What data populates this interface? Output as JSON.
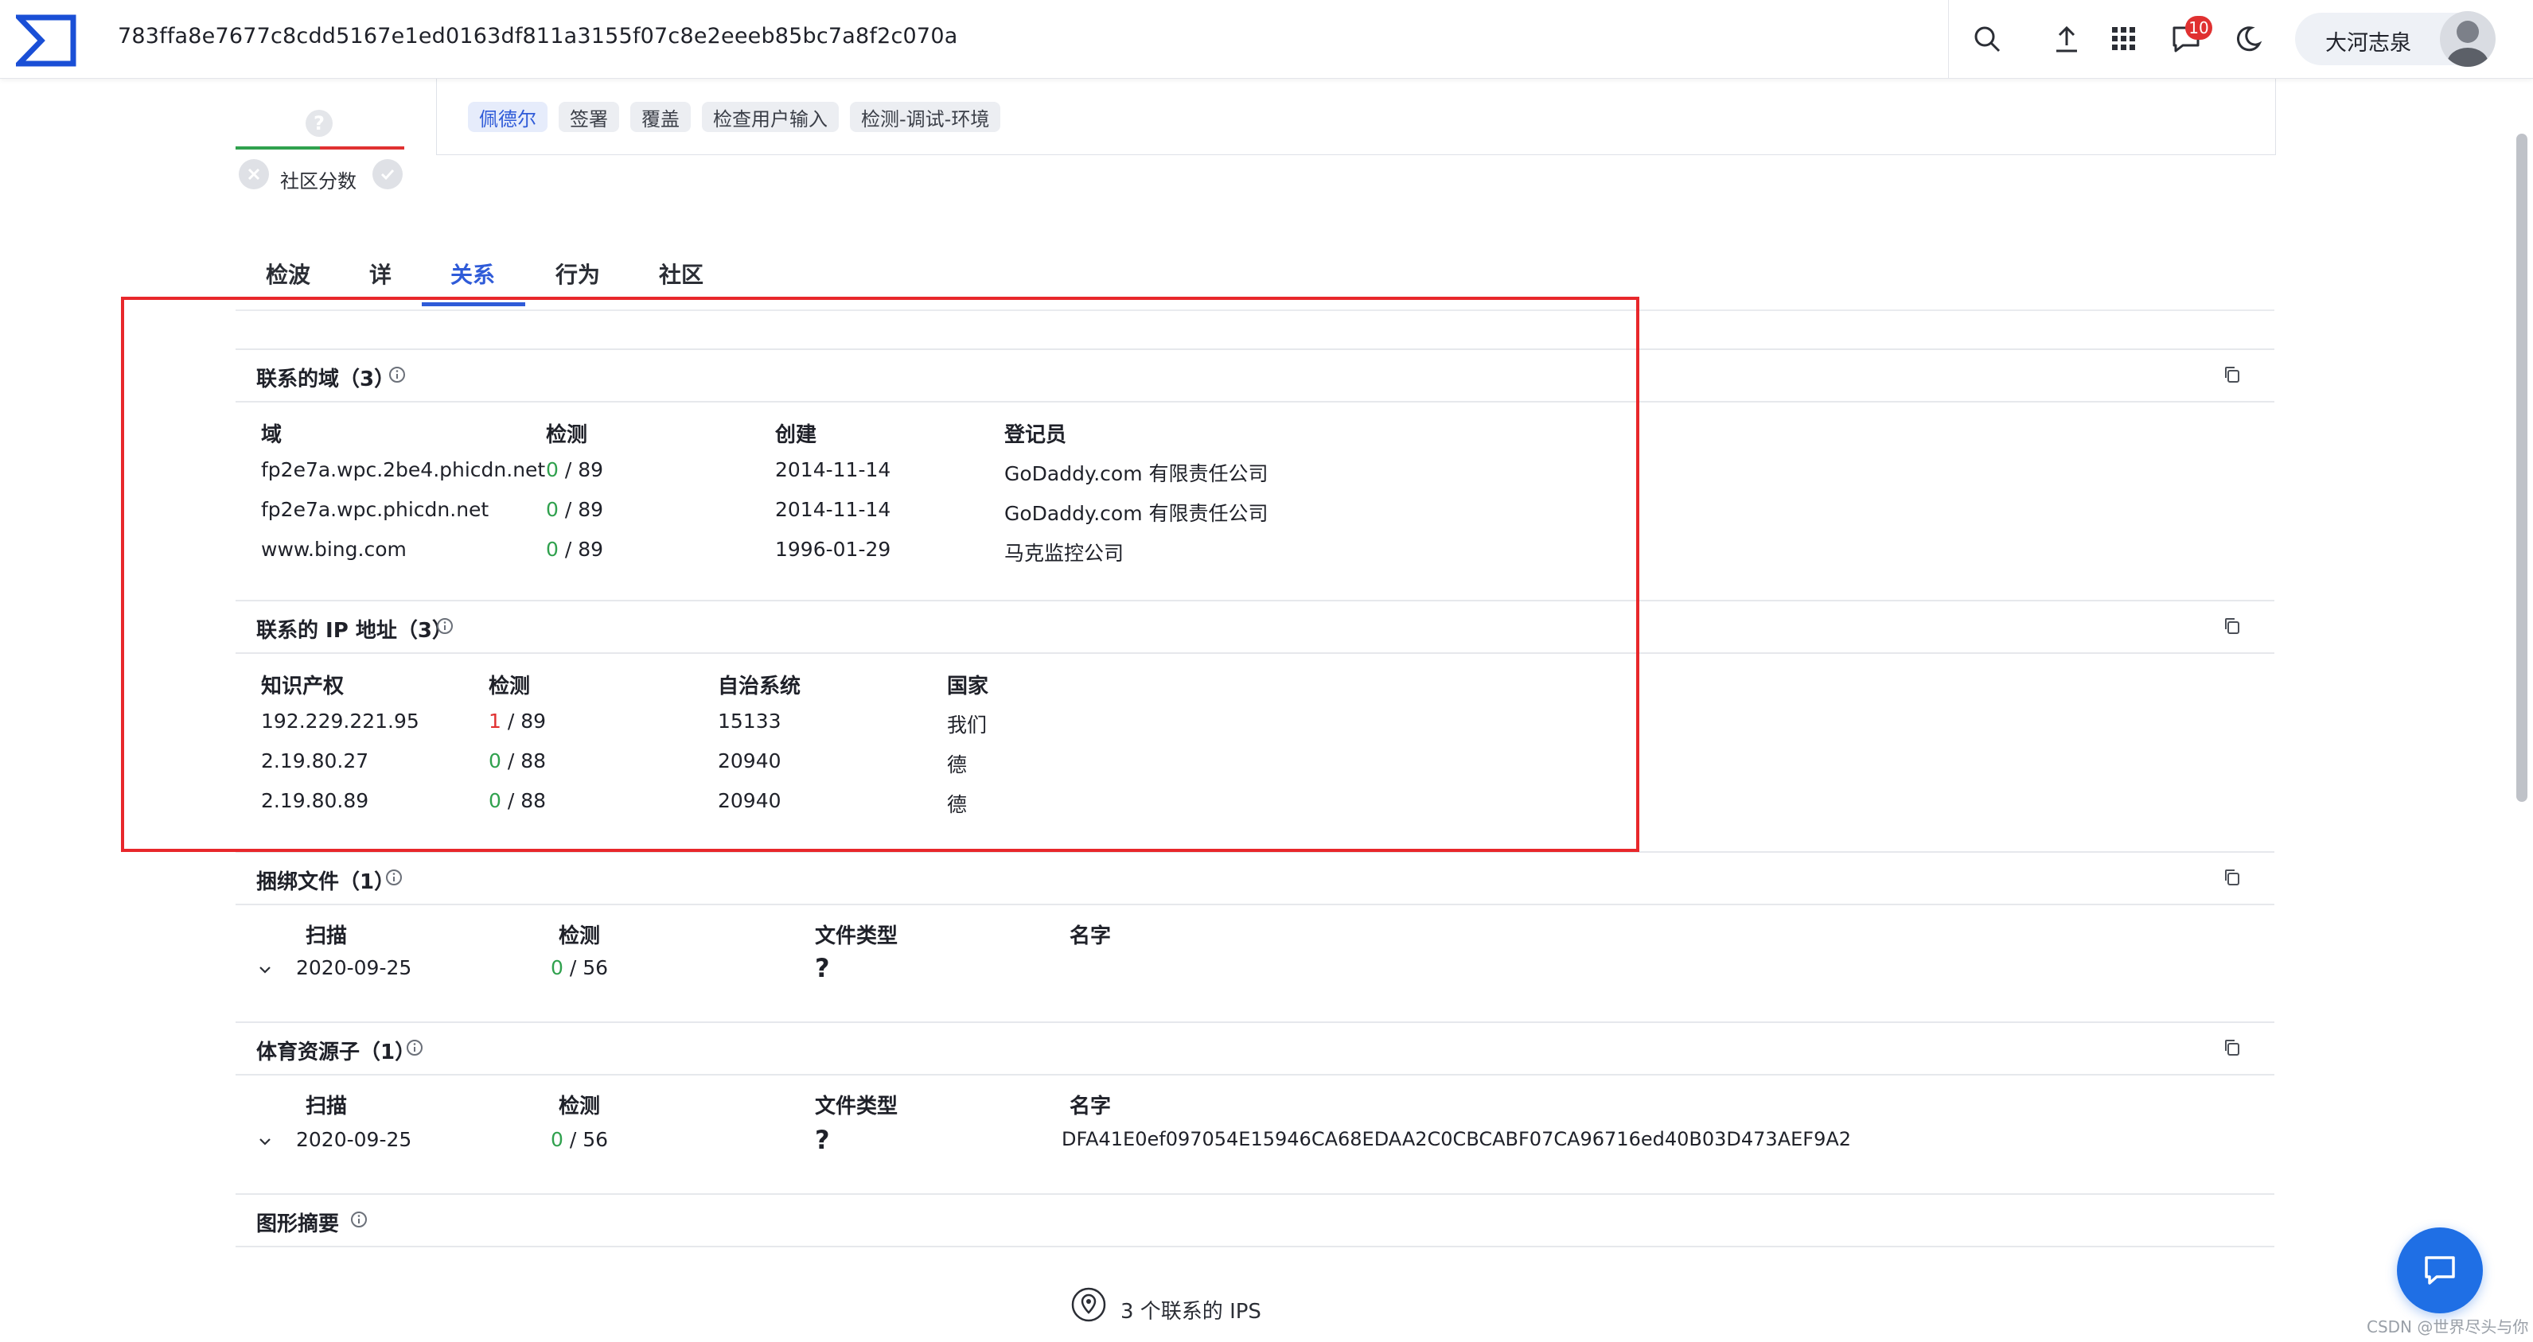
{
  "topbar": {
    "hash": "783ffa8e7677c8cdd5167e1ed0163df811a3155f07c8e2eeeb85bc7a8f2c070a",
    "notification_count": "10",
    "user_name": "大河志泉",
    "icons": [
      "search-icon",
      "upload-icon",
      "apps-grid-icon",
      "chat-icon",
      "moon-icon",
      "avatar"
    ]
  },
  "header": {
    "tags": [
      "佩德尔",
      "签署",
      "覆盖",
      "检查用户输入",
      "检测-调试-环境"
    ],
    "community_score_label": "社区分数",
    "score_symbol": "?"
  },
  "tabs": [
    "检波",
    "详",
    "关系",
    "行为",
    "社区"
  ],
  "active_tab": "关系",
  "contacted_domains": {
    "title": "联系的域（3）",
    "columns": [
      "域",
      "检测",
      "创建",
      "登记员"
    ],
    "rows": [
      {
        "domain": "fp2e7a.wpc.2be4.phicdn.net",
        "det_pos": "0",
        "det_total": " / 89",
        "created": "2014-11-14",
        "registrar": "GoDaddy.com 有限责任公司"
      },
      {
        "domain": "fp2e7a.wpc.phicdn.net",
        "det_pos": "0",
        "det_total": " / 89",
        "created": "2014-11-14",
        "registrar": "GoDaddy.com 有限责任公司"
      },
      {
        "domain": "www.bing.com",
        "det_pos": "0",
        "det_total": " / 89",
        "created": "1996-01-29",
        "registrar": "马克监控公司"
      }
    ]
  },
  "contacted_ips": {
    "title": "联系的 IP 地址（3）",
    "columns": [
      "知识产权",
      "检测",
      "自治系统",
      "国家"
    ],
    "rows": [
      {
        "ip": "192.229.221.95",
        "det_pos": "1",
        "det_total": " / 89",
        "asn": "15133",
        "country": "我们"
      },
      {
        "ip": "2.19.80.27",
        "det_pos": "0",
        "det_total": " / 88",
        "asn": "20940",
        "country": "德"
      },
      {
        "ip": "2.19.80.89",
        "det_pos": "0",
        "det_total": " / 88",
        "asn": "20940",
        "country": "德"
      }
    ]
  },
  "bundled_files": {
    "title": "捆绑文件（1）",
    "columns": [
      "扫描",
      "检测",
      "文件类型",
      "名字"
    ],
    "rows": [
      {
        "scan": "2020-09-25",
        "det_pos": "0",
        "det_total": " / 56",
        "file_type": "?",
        "name": ""
      }
    ]
  },
  "pe_resource_children": {
    "title": "体育资源子（1）",
    "columns": [
      "扫描",
      "检测",
      "文件类型",
      "名字"
    ],
    "rows": [
      {
        "scan": "2020-09-25",
        "det_pos": "0",
        "det_total": " / 56",
        "file_type": "?",
        "name": "DFA41E0ef097054E15946CA68EDAA2C0CBCABF07CA96716ed40B03D473AEF9A2"
      }
    ]
  },
  "graph_summary": {
    "title": "图形摘要"
  },
  "footer": {
    "contacted_ips_label": "3 个联系的 IPS",
    "watermark": "CSDN @世界尽头与你"
  },
  "colors": {
    "accent": "#2f5bd8",
    "clean": "#30a14e",
    "malicious": "#e03131",
    "highlight_box": "#e8272b",
    "fab": "#1f6fe5"
  }
}
